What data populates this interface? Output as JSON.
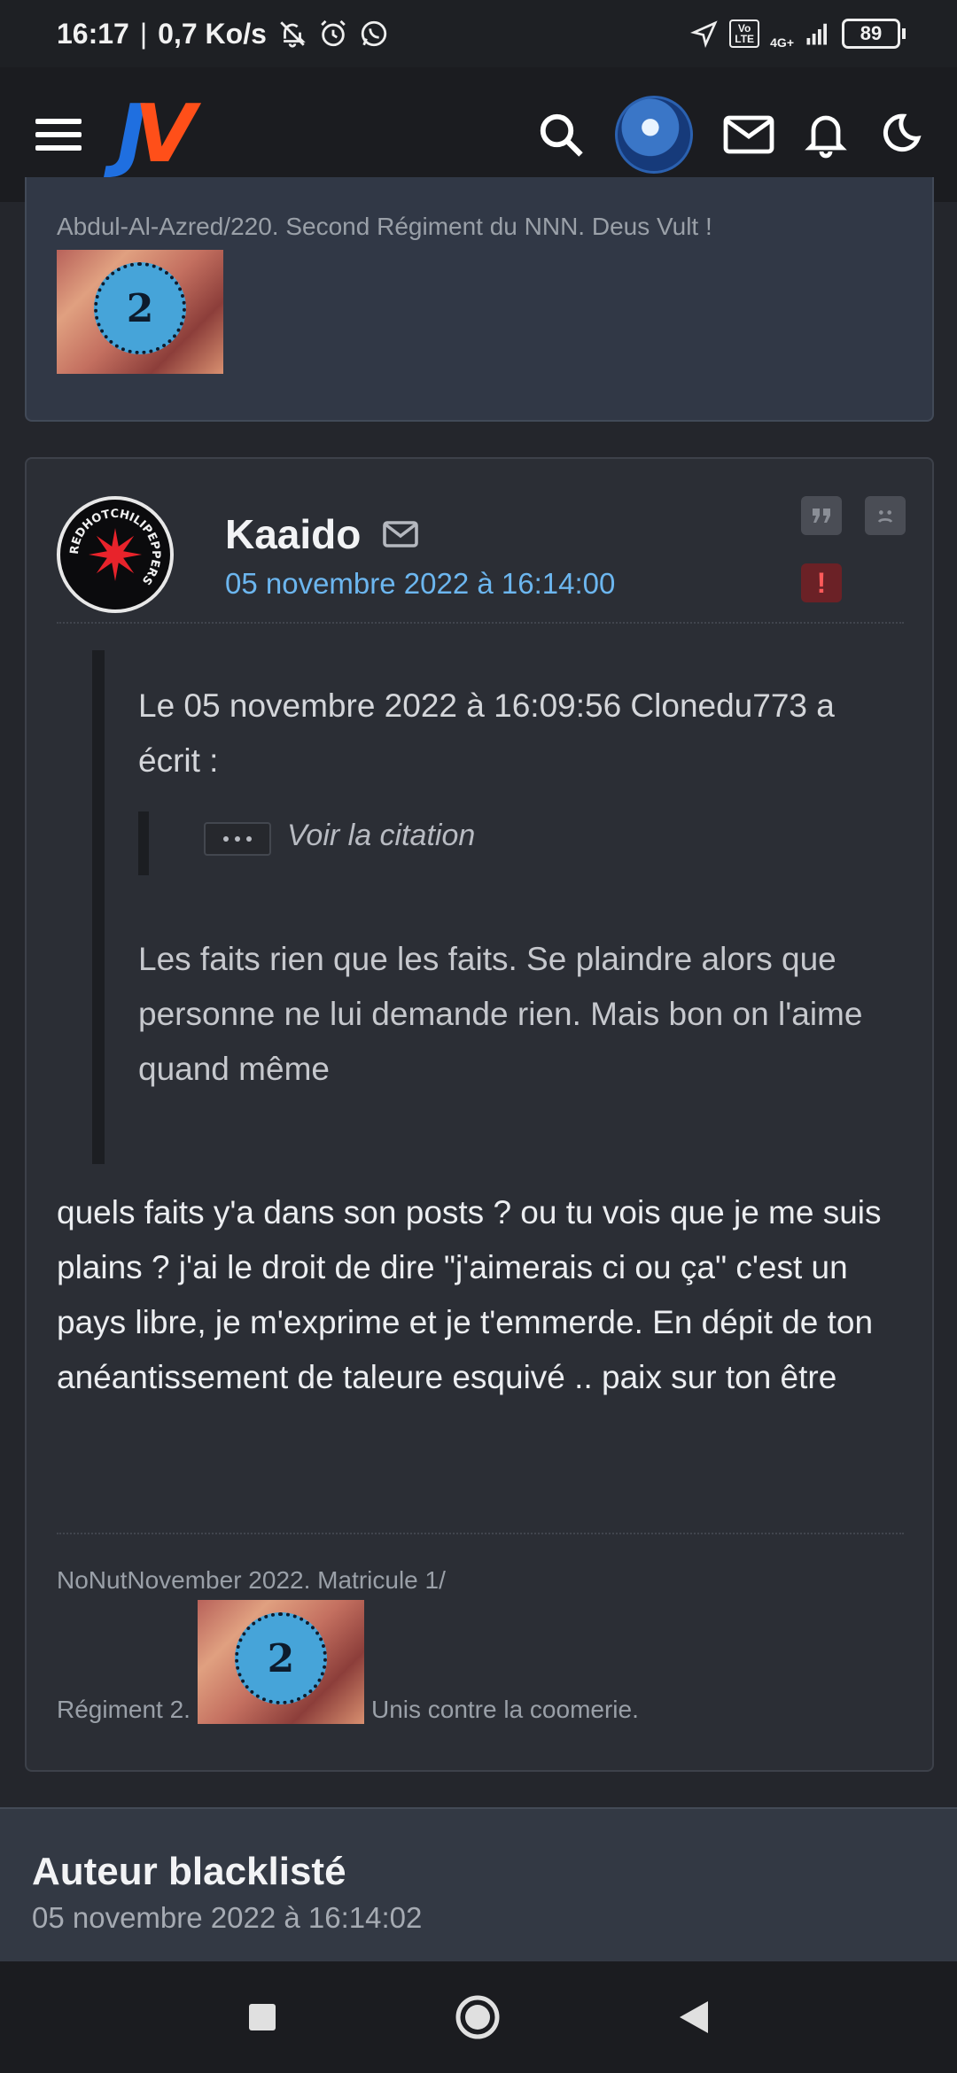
{
  "status_bar": {
    "time": "16:17",
    "speed": "0,7 Ko/s",
    "network": "4G+",
    "volte": "Vo LTE",
    "battery": "89"
  },
  "top_bar": {
    "logo_j": "J",
    "logo_v": "V",
    "colors": {
      "logo_j": "#1f6fe0",
      "logo_v": "#ff4f19"
    }
  },
  "previous_post": {
    "signature_text": "Abdul-Al-Azred/220. Second Régiment du NNN. Deus Vult !",
    "banner_number": "2"
  },
  "post": {
    "author": "Kaaido",
    "date": "05 novembre 2022 à 16:14:00",
    "avatar_ring_text": "REDHOTCHILIPEPPERS",
    "quote": {
      "header": "Le 05 novembre 2022 à 16:09:56 Clonedu773 a écrit :",
      "nested_label": "Voir la citation",
      "body": "Les faits rien que les faits. Se plaindre alors que personne ne lui demande rien. Mais bon on l'aime quand même"
    },
    "message": "quels faits y'a dans son posts ? ou tu vois que je me suis plains ? j'ai le droit de dire \"j'aimerais ci ou ça\" c'est un pays libre, je m'exprime et je t'emmerde. En dépit de ton anéantissement de taleure esquivé .. paix sur ton être",
    "signature": {
      "line1": "NoNutNovember 2022. Matricule 1/",
      "line2_left": "Régiment 2.",
      "line2_right": "Unis contre la coomerie.",
      "banner_number": "2"
    },
    "alert_label": "!"
  },
  "blacklisted": {
    "title": "Auteur blacklisté",
    "date": "05 novembre 2022 à 16:14:02"
  }
}
